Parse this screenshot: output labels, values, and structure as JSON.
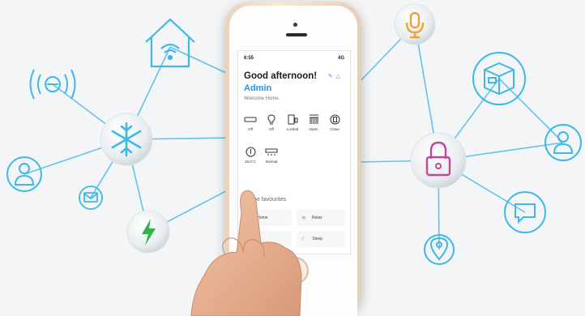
{
  "phone": {
    "status_time": "6:55",
    "status_right": "4G",
    "greeting": "Good afternoon!",
    "username": "Admin",
    "welcome": "Welcome Home.",
    "header_icons": "✎ ♫",
    "devices": [
      {
        "label": "Off",
        "icon": "ac-unit-icon"
      },
      {
        "label": "Off",
        "icon": "bulb-icon"
      },
      {
        "label": "Locked",
        "icon": "door-lock-icon"
      },
      {
        "label": "Open",
        "icon": "blinds-icon"
      },
      {
        "label": "Close",
        "icon": "device-icon"
      },
      {
        "label": "25.0°C",
        "icon": "thermometer-icon"
      },
      {
        "label": "Normal",
        "icon": "ac-mode-icon"
      }
    ],
    "favourites_title": "Scene favourites",
    "scenes": [
      {
        "label": "Home",
        "icon": "home-scene-icon"
      },
      {
        "label": "Relax",
        "icon": "relax-icon"
      },
      {
        "label": "",
        "icon": "scene-icon"
      },
      {
        "label": "Sleep",
        "icon": "sleep-icon"
      }
    ]
  },
  "nodes": [
    {
      "name": "wifi-home-icon",
      "accent": "#3db8e8"
    },
    {
      "name": "microphone-icon",
      "accent": "#f0a23a"
    },
    {
      "name": "wireless-signal-icon",
      "accent": "#3db8e8"
    },
    {
      "name": "snowflake-icon",
      "accent": "#3db8e8"
    },
    {
      "name": "package-box-icon",
      "accent": "#3db8e8"
    },
    {
      "name": "padlock-icon",
      "accent": "#c2479a"
    },
    {
      "name": "user-icon",
      "accent": "#3db8e8"
    },
    {
      "name": "mail-icon",
      "accent": "#3db8e8"
    },
    {
      "name": "lightning-icon",
      "accent": "#35b24a"
    },
    {
      "name": "chat-bubble-icon",
      "accent": "#3db8e8"
    },
    {
      "name": "location-pin-icon",
      "accent": "#3db8e8"
    }
  ],
  "colors": {
    "line": "#63c3ec",
    "phone_gold": "#ead6bf",
    "brand_blue": "#2f8fe0"
  }
}
